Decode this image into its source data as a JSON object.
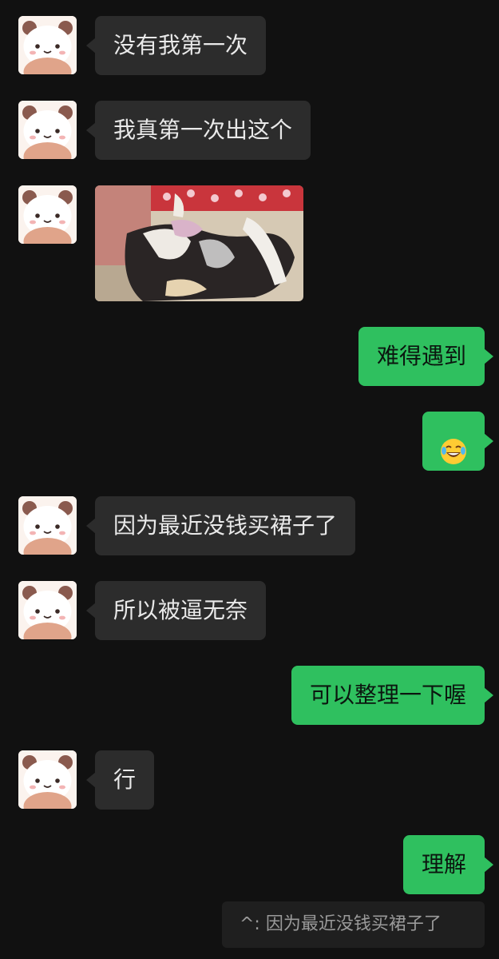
{
  "messages": [
    {
      "side": "in",
      "text": "没有我第一次"
    },
    {
      "side": "in",
      "text": "我真第一次出这个"
    },
    {
      "side": "in",
      "type": "image"
    },
    {
      "side": "out",
      "text": "难得遇到"
    },
    {
      "side": "out",
      "type": "emoji",
      "emoji": "tears-of-joy-emoji"
    },
    {
      "side": "in",
      "text": "因为最近没钱买裙子了"
    },
    {
      "side": "in",
      "text": "所以被逼无奈"
    },
    {
      "side": "out",
      "text": "可以整理一下喔"
    },
    {
      "side": "in",
      "text": "行"
    },
    {
      "side": "out",
      "text": "理解"
    }
  ],
  "quote": {
    "text": "^: 因为最近没钱买裙子了"
  },
  "colors": {
    "background": "#111111",
    "incoming_bubble": "#2c2c2c",
    "outgoing_bubble": "#2fc05f"
  }
}
